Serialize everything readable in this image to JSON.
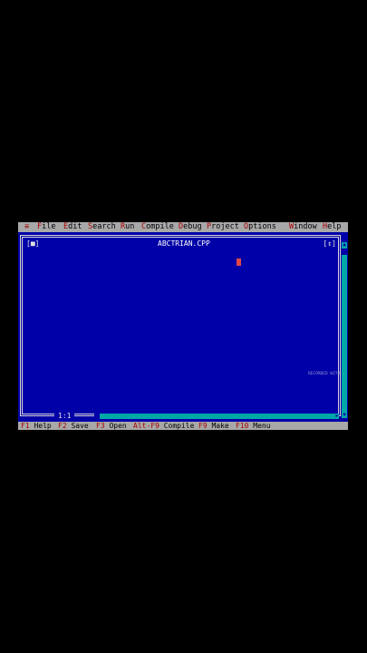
{
  "menubar": {
    "system": "≡",
    "items": [
      {
        "hotkey": "F",
        "rest": "ile"
      },
      {
        "hotkey": "E",
        "rest": "dit"
      },
      {
        "hotkey": "S",
        "rest": "earch"
      },
      {
        "hotkey": "R",
        "rest": "un"
      },
      {
        "hotkey": "C",
        "rest": "ompile"
      },
      {
        "hotkey": "D",
        "rest": "ebug"
      },
      {
        "hotkey": "P",
        "rest": "roject"
      },
      {
        "hotkey": "O",
        "rest": "ptions"
      },
      {
        "hotkey": "W",
        "rest": "indow"
      },
      {
        "hotkey": "H",
        "rest": "elp"
      }
    ]
  },
  "editor": {
    "close_button": "[■]",
    "zoom_button": "[↕]",
    "title": "ABCTRIAN.CPP",
    "cursor_position": "1:1",
    "stamp_text": "RECORDED WITH"
  },
  "icons": {
    "up_arrow": "▲",
    "down_arrow": "▼",
    "right_arrow": "►"
  },
  "statusbar": {
    "items": [
      {
        "key": "F1",
        "label": " Help"
      },
      {
        "key": "F2",
        "label": " Save"
      },
      {
        "key": "F3",
        "label": " Open"
      },
      {
        "key": "Alt-F9",
        "label": " Compile"
      },
      {
        "key": "F9",
        "label": " Make"
      },
      {
        "key": "F10",
        "label": " Menu"
      }
    ]
  },
  "colors": {
    "desktop": "#0000a8",
    "menubar": "#a8a8a8",
    "hotkey": "#a80000",
    "scrollbar": "#00a8a8"
  }
}
